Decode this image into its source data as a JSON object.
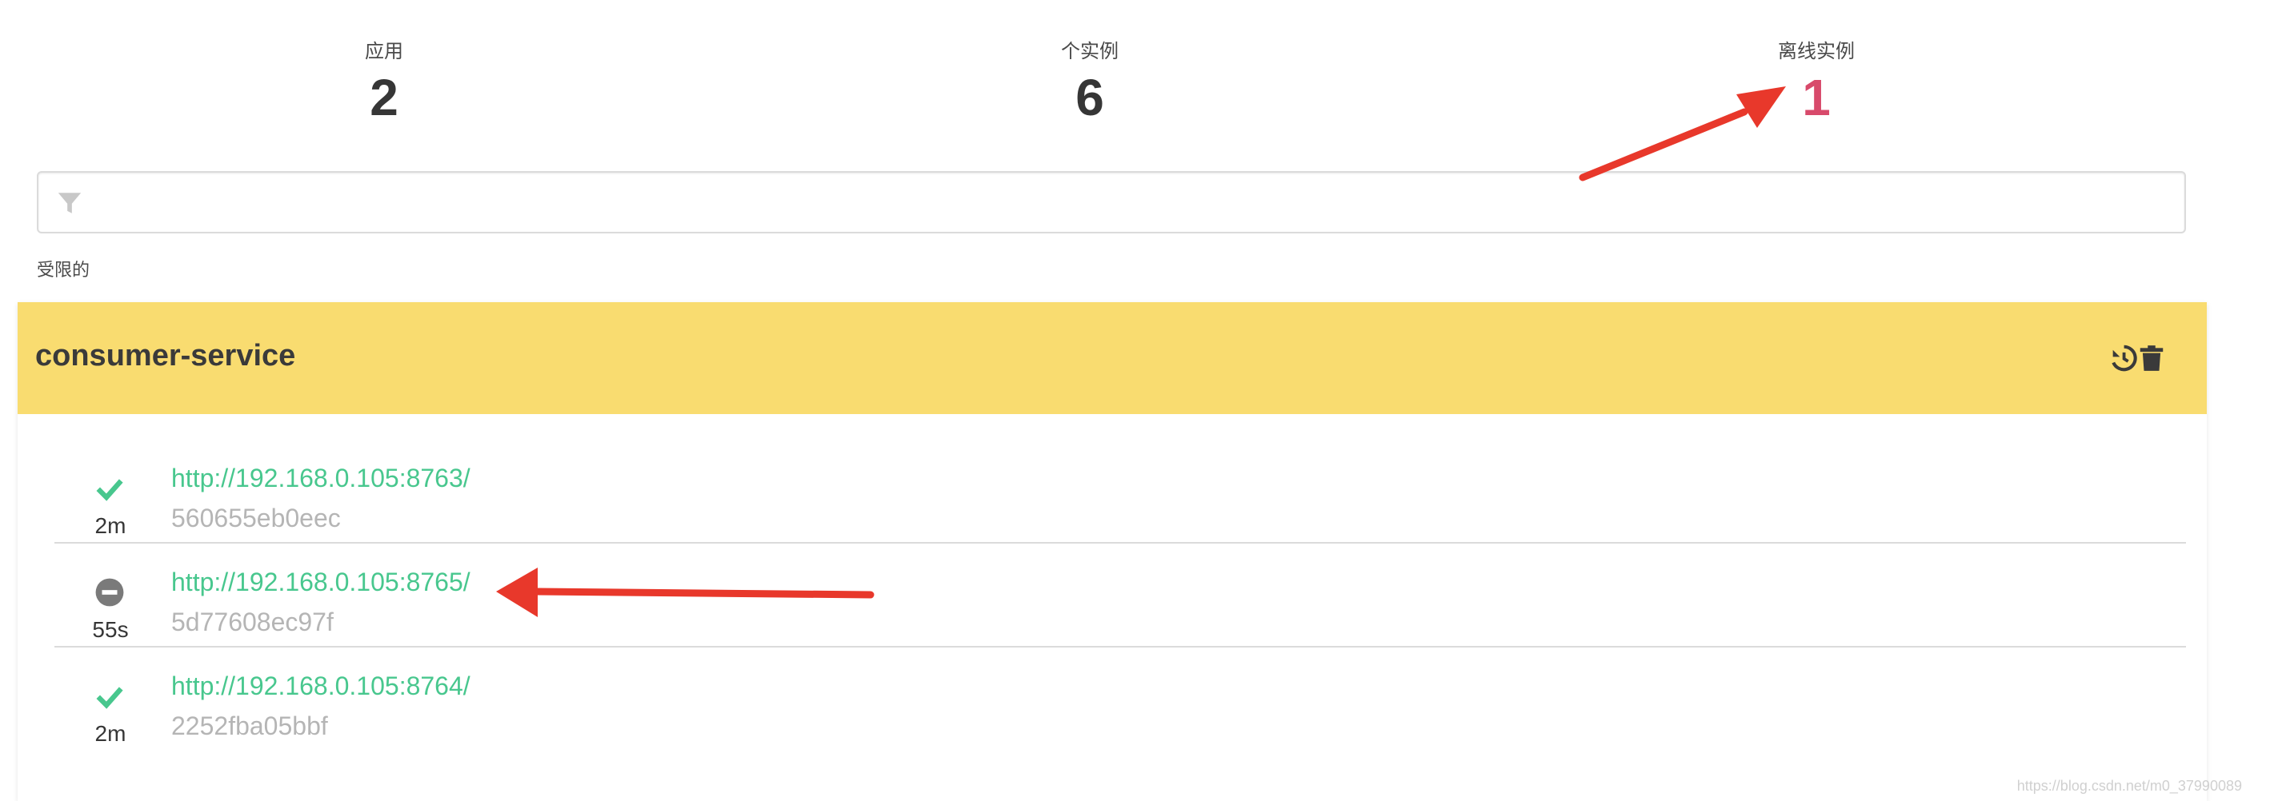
{
  "stats": {
    "applications": {
      "label": "应用",
      "value": "2"
    },
    "instances": {
      "label": "个实例",
      "value": "6"
    },
    "offline": {
      "label": "离线实例",
      "value": "1"
    }
  },
  "filter": {
    "placeholder": "",
    "icon": "filter-icon"
  },
  "section_label": "受限的",
  "application": {
    "name": "consumer-service",
    "header_color": "#f9dc70",
    "actions": [
      {
        "icon": "history-icon",
        "name": "unregister"
      },
      {
        "icon": "trash-icon",
        "name": "remove"
      }
    ],
    "instances": [
      {
        "status": "UP",
        "status_icon": "check-icon",
        "since": "2m",
        "url": "http://192.168.0.105:8763/",
        "id": "560655eb0eec"
      },
      {
        "status": "OFFLINE",
        "status_icon": "minus-circle-icon",
        "since": "55s",
        "url": "http://192.168.0.105:8765/",
        "id": "5d77608ec97f"
      },
      {
        "status": "UP",
        "status_icon": "check-icon",
        "since": "2m",
        "url": "http://192.168.0.105:8764/",
        "id": "2252fba05bbf"
      }
    ]
  },
  "colors": {
    "up": "#48c78e",
    "offline": "#7a7a7a",
    "danger": "#d84a6b",
    "annotation_arrow": "#e8382b"
  },
  "watermark": "https://blog.csdn.net/m0_37990089"
}
